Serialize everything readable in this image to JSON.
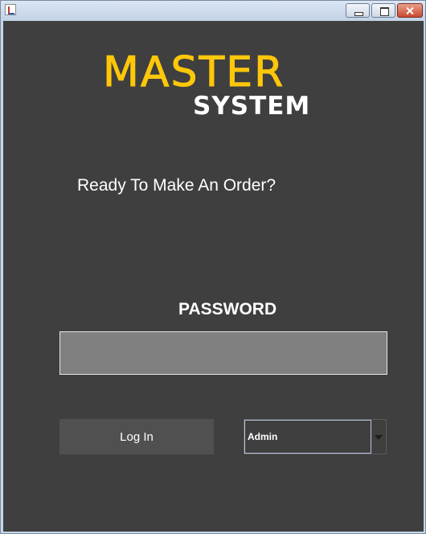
{
  "window": {
    "title": "",
    "icon": "java-cup-icon",
    "controls": [
      "minimize-icon",
      "maximize-icon",
      "close-icon"
    ]
  },
  "logo": {
    "line1": "MASTER",
    "line2": "SYSTEM",
    "colors": {
      "primary": "#fdc70a",
      "secondary": "#ffffff"
    }
  },
  "main": {
    "prompt": "Ready To Make An Order?",
    "password_label": "PASSWORD",
    "password_value": "",
    "login_label": "Log In",
    "role_selected": "Admin"
  },
  "colors": {
    "background": "#3f3f3f",
    "input_background": "#808080",
    "button_background": "#505050"
  }
}
